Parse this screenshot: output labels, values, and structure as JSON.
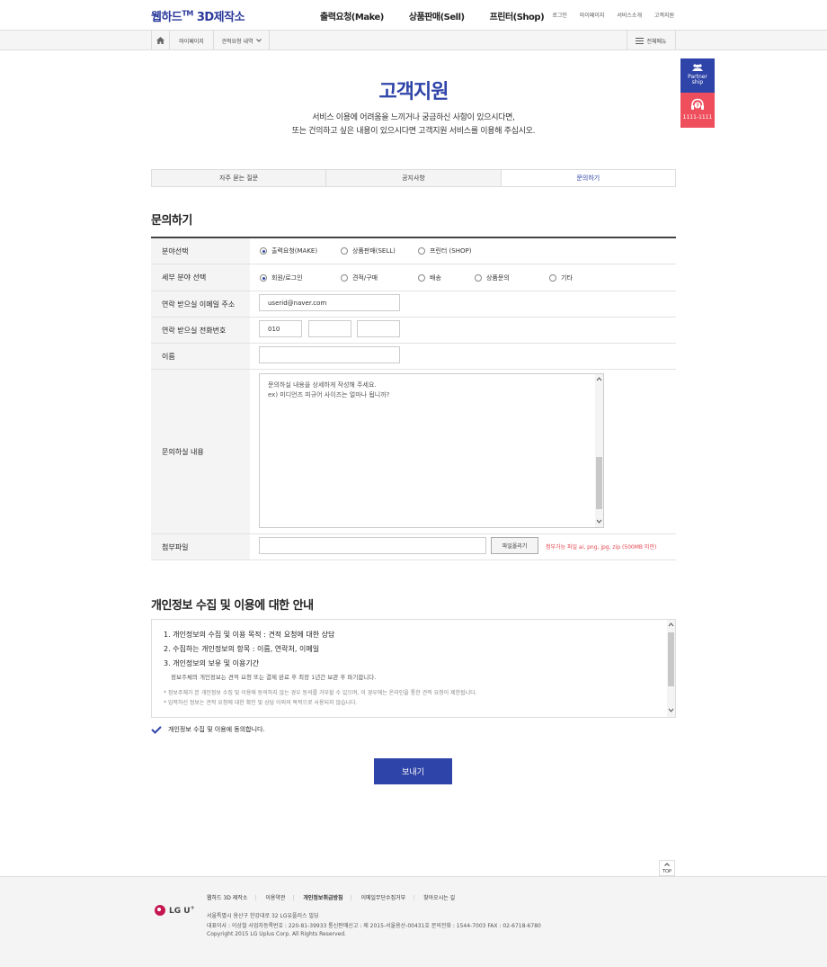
{
  "header": {
    "logo_main": "웹하드",
    "logo_tm": "TM",
    "logo_sub": " 3D제작소",
    "nav": [
      "출력요청(Make)",
      "상품판매(Sell)",
      "프린터(Shop)"
    ],
    "util": [
      "로그인",
      "마이페이지",
      "서비스소개",
      "고객지원"
    ]
  },
  "subnav": {
    "crumbs": [
      "마이페이지",
      "견적요청 내역"
    ],
    "all_menu": "전체메뉴"
  },
  "side": {
    "partner": [
      "Partner",
      "ship"
    ],
    "call": "1111-1111"
  },
  "page": {
    "title": "고객지원",
    "desc_line1": "서비스 이용에 어려움을 느끼거나 궁금하신 사항이 있으시다면,",
    "desc_line2": "또는 건의하고 싶은 내용이 있으시다면 고객지원 서비스를 이용해 주십시오."
  },
  "tabs": [
    "자주 묻는 질문",
    "공지사항",
    "문의하기"
  ],
  "form": {
    "heading": "문의하기",
    "field_label": "분야선택",
    "field_options": [
      "출력요청(MAKE)",
      "상품판매(SELL)",
      "프린터 (SHOP)"
    ],
    "sub_label": "세부 분야 선택",
    "sub_options": [
      "회원/로그인",
      "견적/구매",
      "배송",
      "상품문의",
      "기타"
    ],
    "email_label": "연락 받으실 이메일 주소",
    "email_value": "userid@naver.com",
    "phone_label": "연락 받으실 전화번호",
    "phone_values": [
      "010",
      "",
      ""
    ],
    "name_label": "이름",
    "name_value": "",
    "content_label": "문의하실 내용",
    "content_line1": "문의하실 내용을 상세하게 작성해 주세요.",
    "content_line2": "ex) 미디언즈 피규어 사이즈는 얼마나 됩니까?",
    "file_label": "첨부파일",
    "file_button": "파일올리기",
    "file_note": "첨부가능 파일 ai, png, jpg, zip (500MB 미만)"
  },
  "privacy": {
    "heading": "개인정보 수집 및 이용에 대한 안내",
    "item1": "1. 개인정보의 수집 및 이용 목적 : 견적 요청에 대한 상담",
    "item2": "2. 수집하는 개인정보의 항목 : 이름, 연락처, 이메일",
    "item3": "3. 개인정보의 보유 및 이용기간",
    "item3_sub": "정보주체의 개인정보는 견적 요청 또는 결제 완료 후 최장 1년간 보관 후 파기합니다.",
    "note1": "* 정보주체가 본 개인정보 수집 및 이용에 동의하지 않는 경우 동의를 거부할 수 있으며, 이 경우에는 온라인을 통한 견적 요청이 제한됩니다.",
    "note2": "* 입력하신 정보는 견적 요청에 대한 확인 및 상담 이외의 목적으로 사용되지 않습니다.",
    "agree": "개인정보 수집 및 이용에 동의합니다."
  },
  "submit": "보내기",
  "top_button": "TOP",
  "footer": {
    "links": [
      "웹하드 3D 제작소",
      "이용약관",
      "개인정보취급방침",
      "이메일무단수집거부",
      "찾아오시는 길"
    ],
    "logo": "LG U",
    "logo_plus": "+",
    "address": "서울특별시 용산구 한강대로 32 LG유플러스 빌딩",
    "info": "대표이사 : 이상철    사업자등록번호 : 220-81-39933    통신판매신고 : 제 2015-서울용산-00431호    문의전화 : 1544-7003    FAX : 02-6718-6780",
    "copyright": "Copyright 2015 LG Uplus Corp. All Rights Reserved."
  },
  "colors": {
    "brand": "#2f44a8",
    "call_red": "#ef4f5d",
    "note_red": "#e3464f"
  }
}
